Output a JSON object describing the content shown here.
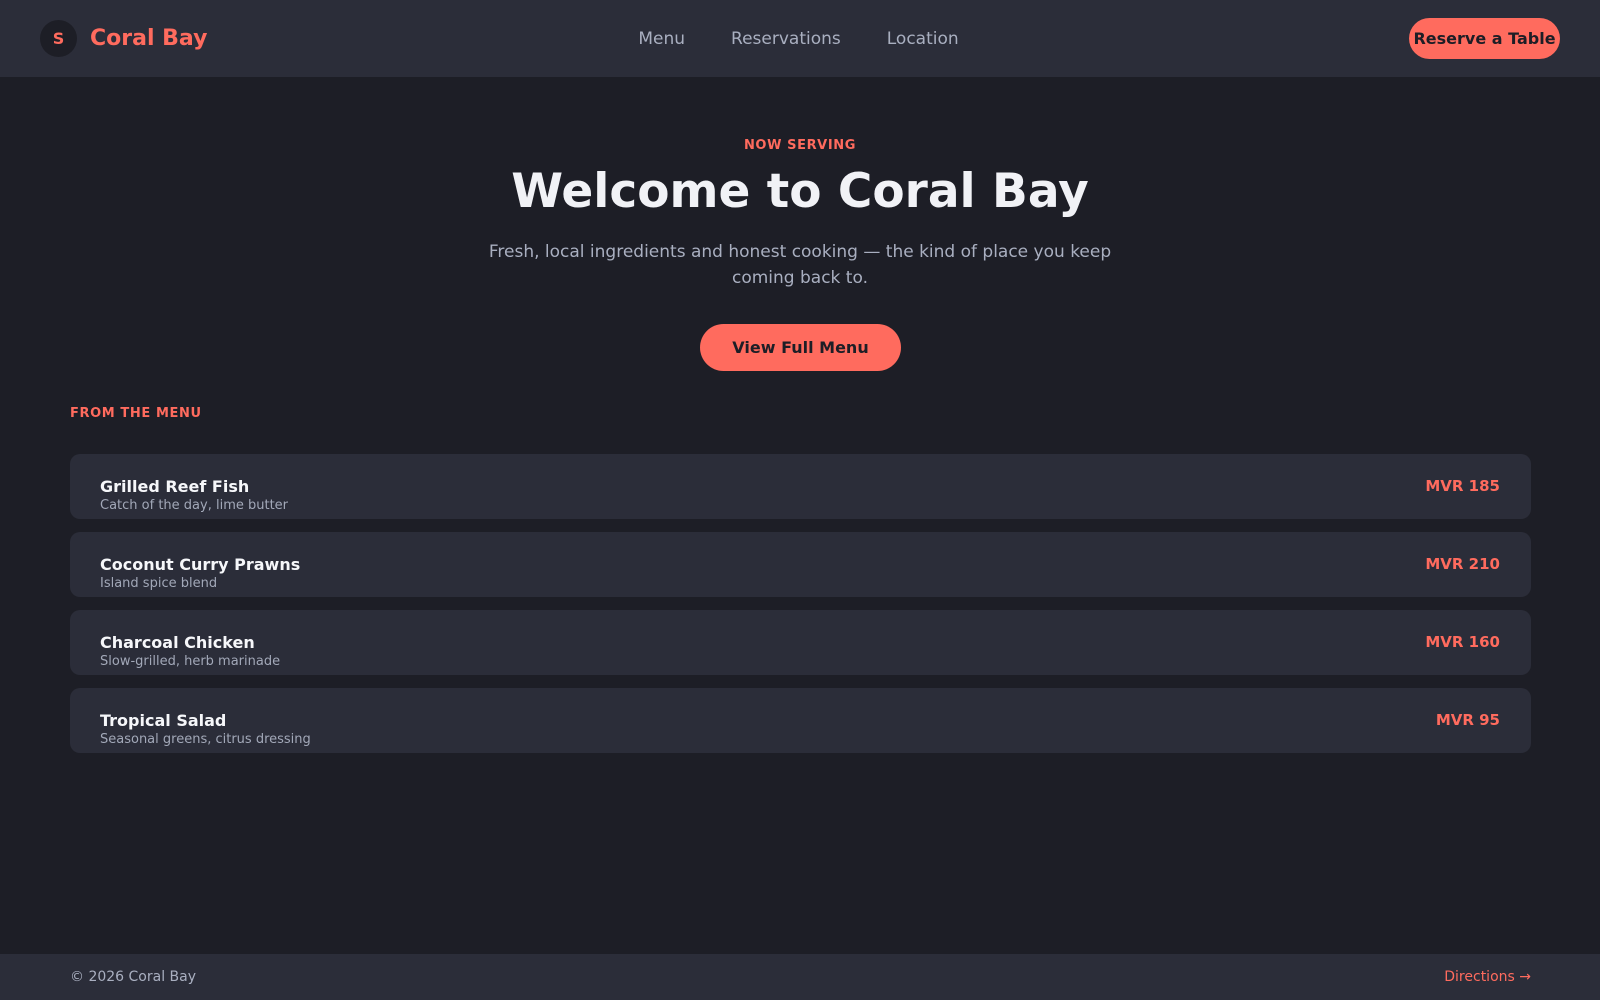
{
  "header": {
    "logo_letter": "S",
    "brand_name": "Coral Bay",
    "nav": [
      {
        "label": "Menu"
      },
      {
        "label": "Reservations"
      },
      {
        "label": "Location"
      }
    ],
    "cta_label": "Reserve a Table"
  },
  "hero": {
    "eyebrow": "NOW SERVING",
    "title": "Welcome to Coral Bay",
    "subtitle": "Fresh, local ingredients and honest cooking — the kind of place you keep coming back to.",
    "cta_label": "View Full Menu"
  },
  "menu": {
    "section_label": "FROM THE MENU",
    "items": [
      {
        "name": "Grilled Reef Fish",
        "description": "Catch of the day, lime butter",
        "price": "MVR 185"
      },
      {
        "name": "Coconut Curry Prawns",
        "description": "Island spice blend",
        "price": "MVR 210"
      },
      {
        "name": "Charcoal Chicken",
        "description": "Slow-grilled, herb marinade",
        "price": "MVR 160"
      },
      {
        "name": "Tropical Salad",
        "description": "Seasonal greens, citrus dressing",
        "price": "MVR 95"
      }
    ]
  },
  "footer": {
    "copyright": "© 2026 Coral Bay",
    "directions_label": "Directions →"
  },
  "colors": {
    "background": "#1d1e26",
    "surface": "#2b2d39",
    "accent": "#ff6b5e",
    "text_primary": "#f1f2f6",
    "text_muted": "#a9afc0"
  }
}
